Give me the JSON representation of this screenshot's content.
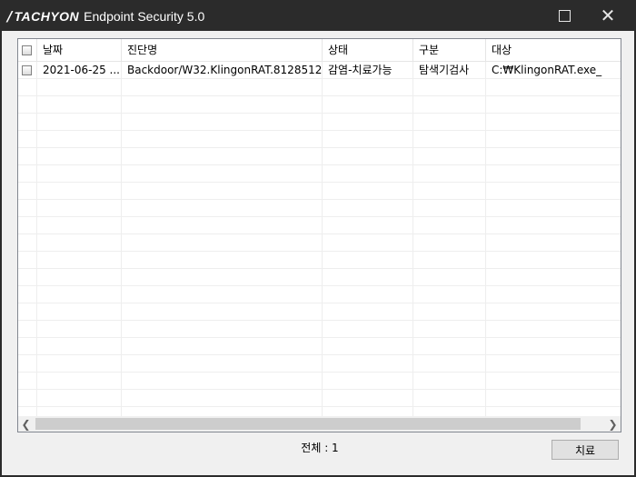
{
  "window": {
    "brand": "TACHYON",
    "title": "Endpoint Security 5.0",
    "maximize_icon": "maximize-icon",
    "close_icon": "close-icon"
  },
  "table": {
    "columns": [
      "날짜",
      "진단명",
      "상태",
      "구분",
      "대상"
    ],
    "rows": [
      {
        "date": "2021-06-25 ...",
        "name": "Backdoor/W32.KlingonRAT.8128512",
        "status": "감염-치료가능",
        "type": "탐색기검사",
        "target": "C:₩KlingonRAT.exe_"
      }
    ]
  },
  "footer": {
    "total_label": "전체 : 1",
    "cure_button": "치료"
  }
}
